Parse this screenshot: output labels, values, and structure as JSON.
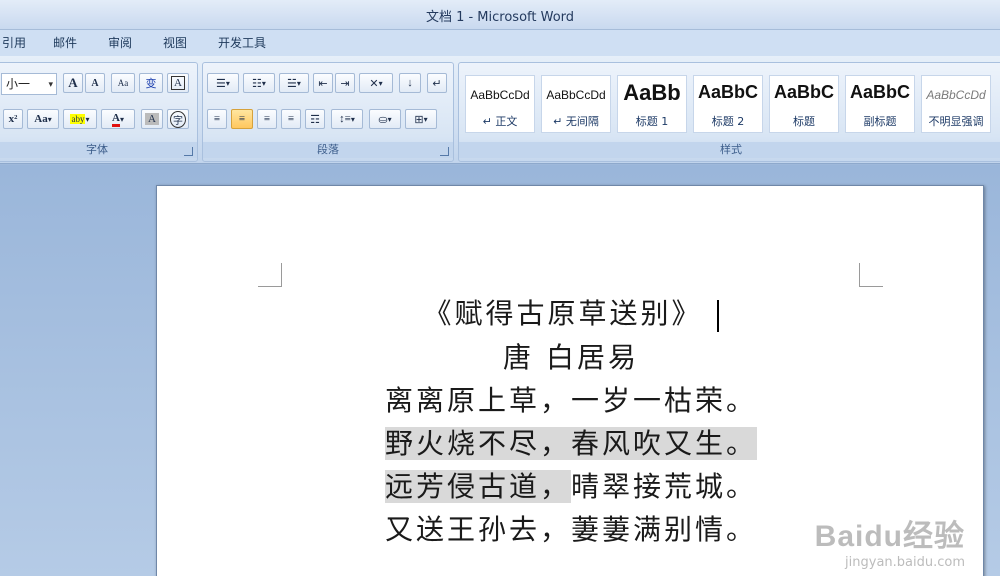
{
  "window": {
    "title": "文档 1 - Microsoft Word"
  },
  "tabs": [
    "引用",
    "邮件",
    "审阅",
    "视图",
    "开发工具"
  ],
  "font_group": {
    "label": "字体",
    "font_size": "小一",
    "buttons": {
      "grow": "A",
      "shrink": "A",
      "clear_format": "Aa",
      "phonetic": "变",
      "char_border": "A",
      "superscript": "x²",
      "change_case": "Aa",
      "highlight": "aby",
      "font_color": "A",
      "char_shading": "A",
      "enclose": "字"
    }
  },
  "paragraph_group": {
    "label": "段落"
  },
  "styles_group": {
    "label": "样式",
    "styles": [
      {
        "sample": "AaBbCcDd",
        "name": "↵ 正文"
      },
      {
        "sample": "AaBbCcDd",
        "name": "↵ 无间隔"
      },
      {
        "sample": "AaBb",
        "name": "标题 1"
      },
      {
        "sample": "AaBbC",
        "name": "标题 2"
      },
      {
        "sample": "AaBbC",
        "name": "标题"
      },
      {
        "sample": "AaBbC",
        "name": "副标题"
      },
      {
        "sample": "AaBbCcDd",
        "name": "不明显强调"
      }
    ]
  },
  "document": {
    "title": "《赋得古原草送别》",
    "author": "唐  白居易",
    "lines": [
      "离离原上草，一岁一枯荣。",
      "野火烧不尽，春风吹又生。",
      "远芳侵古道，",
      "晴翠接荒城。",
      "又送王孙去，萋萋满别情。"
    ]
  },
  "watermark": {
    "brand": "Baidu经验",
    "url": "jingyan.baidu.com"
  }
}
